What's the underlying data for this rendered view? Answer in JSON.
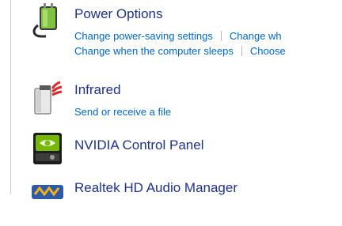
{
  "items": [
    {
      "title": "Power Options",
      "icon": "power-options-icon",
      "links_row1": [
        "Change power-saving settings",
        "Change wh"
      ],
      "links_row2": [
        "Change when the computer sleeps",
        "Choose"
      ]
    },
    {
      "title": "Infrared",
      "icon": "infrared-icon",
      "link": "Send or receive a file"
    },
    {
      "title": "NVIDIA Control Panel",
      "icon": "nvidia-icon"
    },
    {
      "title": "Realtek HD Audio Manager",
      "icon": "realtek-audio-icon"
    }
  ],
  "colors": {
    "title": "#1e3287",
    "link": "#0066cc",
    "separator": "#b8b8b8"
  }
}
